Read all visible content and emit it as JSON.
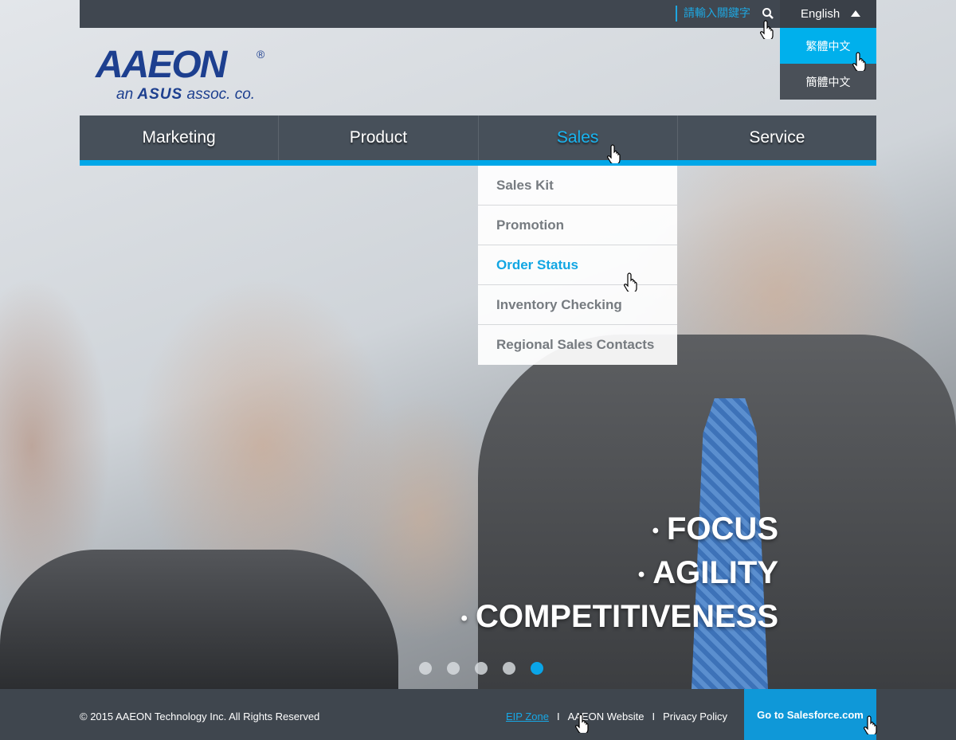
{
  "topbar": {
    "search_placeholder": "請輸入關鍵字",
    "language_current": "English",
    "language_options": [
      "繁體中文",
      "簡體中文"
    ]
  },
  "logo": {
    "brand": "AAEON",
    "registered": "®",
    "tagline_prefix": "an",
    "tagline_brand": "ASUS",
    "tagline_suffix": "assoc. co."
  },
  "nav": {
    "items": [
      "Marketing",
      "Product",
      "Sales",
      "Service"
    ],
    "active": "Sales"
  },
  "dropdown": {
    "items": [
      "Sales Kit",
      "Promotion",
      "Order Status",
      "Inventory Checking",
      "Regional Sales Contacts"
    ],
    "active": "Order Status"
  },
  "hero": {
    "slogans": [
      "FOCUS",
      "AGILITY",
      "COMPETITIVENESS"
    ],
    "bullet": "•",
    "slide_count": 5,
    "active_slide": 5
  },
  "footer": {
    "copyright": "© 2015 AAEON Technology Inc. All Rights Reserved",
    "links": [
      "EIP Zone",
      "AAEON Website",
      "Privacy Policy"
    ],
    "separator": "I",
    "salesforce_button": "Go to Salesforce.com"
  },
  "colors": {
    "accent": "#00a7e8",
    "bar": "#404750",
    "nav": "#47505a",
    "logo": "#1d3f8f"
  }
}
